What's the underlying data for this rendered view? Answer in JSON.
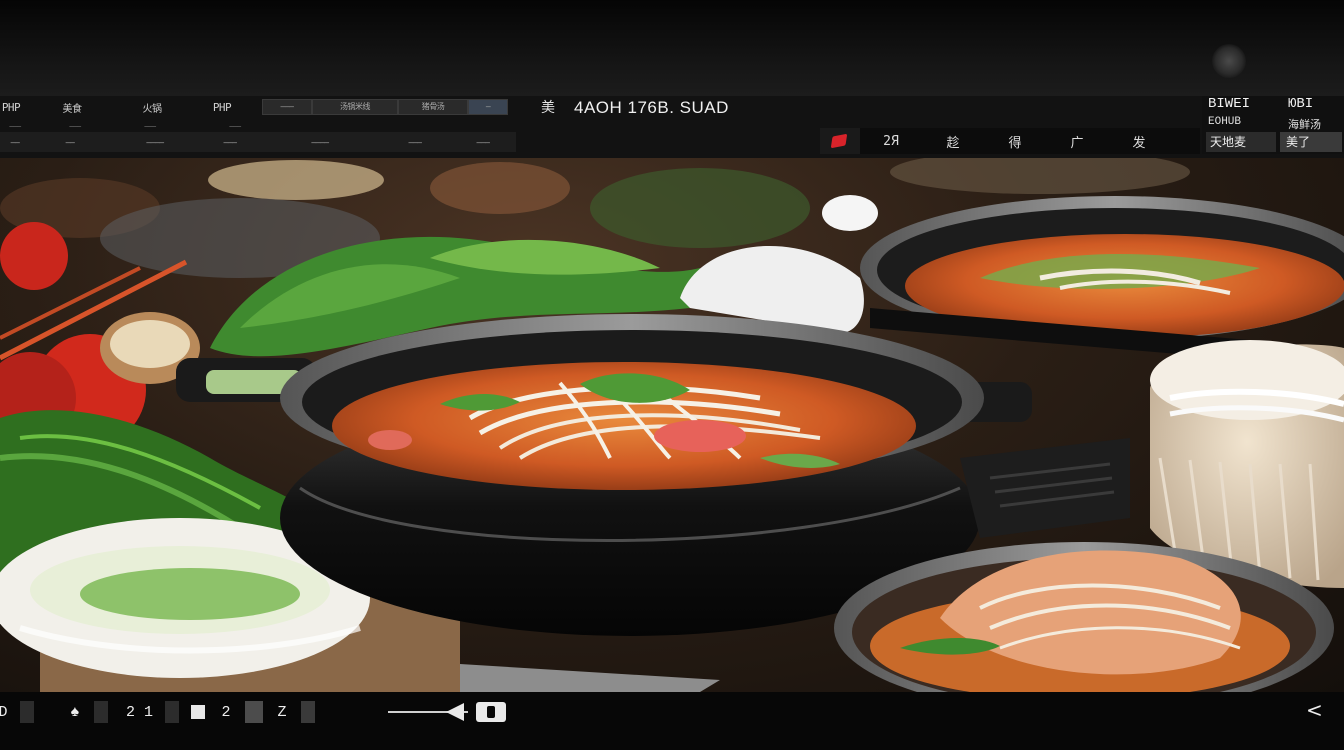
{
  "header": {
    "left_row1": [
      "PHP",
      "美食",
      "火锅",
      "PHP",
      "———",
      "汤锅米线",
      "猪骨汤",
      "—"
    ],
    "left_row2": [
      "———",
      "———",
      "———",
      "———"
    ],
    "left_row3": [
      "——",
      "——",
      "————",
      "———",
      "————",
      "———",
      "———"
    ],
    "title_glyph": "美",
    "title": "4AOH 176B. SUAD",
    "mid_items": [
      "2Я",
      "趁",
      "得",
      "广",
      "发"
    ],
    "right_r1a": "BIWEI",
    "right_r1b": "ЮBI",
    "right_r2a": "EOHUB",
    "right_r2b": "海鲜汤",
    "right_r3a": "天地麦",
    "right_r3b": "美了"
  },
  "bottom": {
    "items": [
      "D",
      "♠",
      "2 1",
      "2",
      "Z"
    ],
    "back": "<"
  },
  "colors": {
    "record": "#d8232a",
    "soup": "#d86a2c",
    "pot": "#1a1a1a"
  }
}
